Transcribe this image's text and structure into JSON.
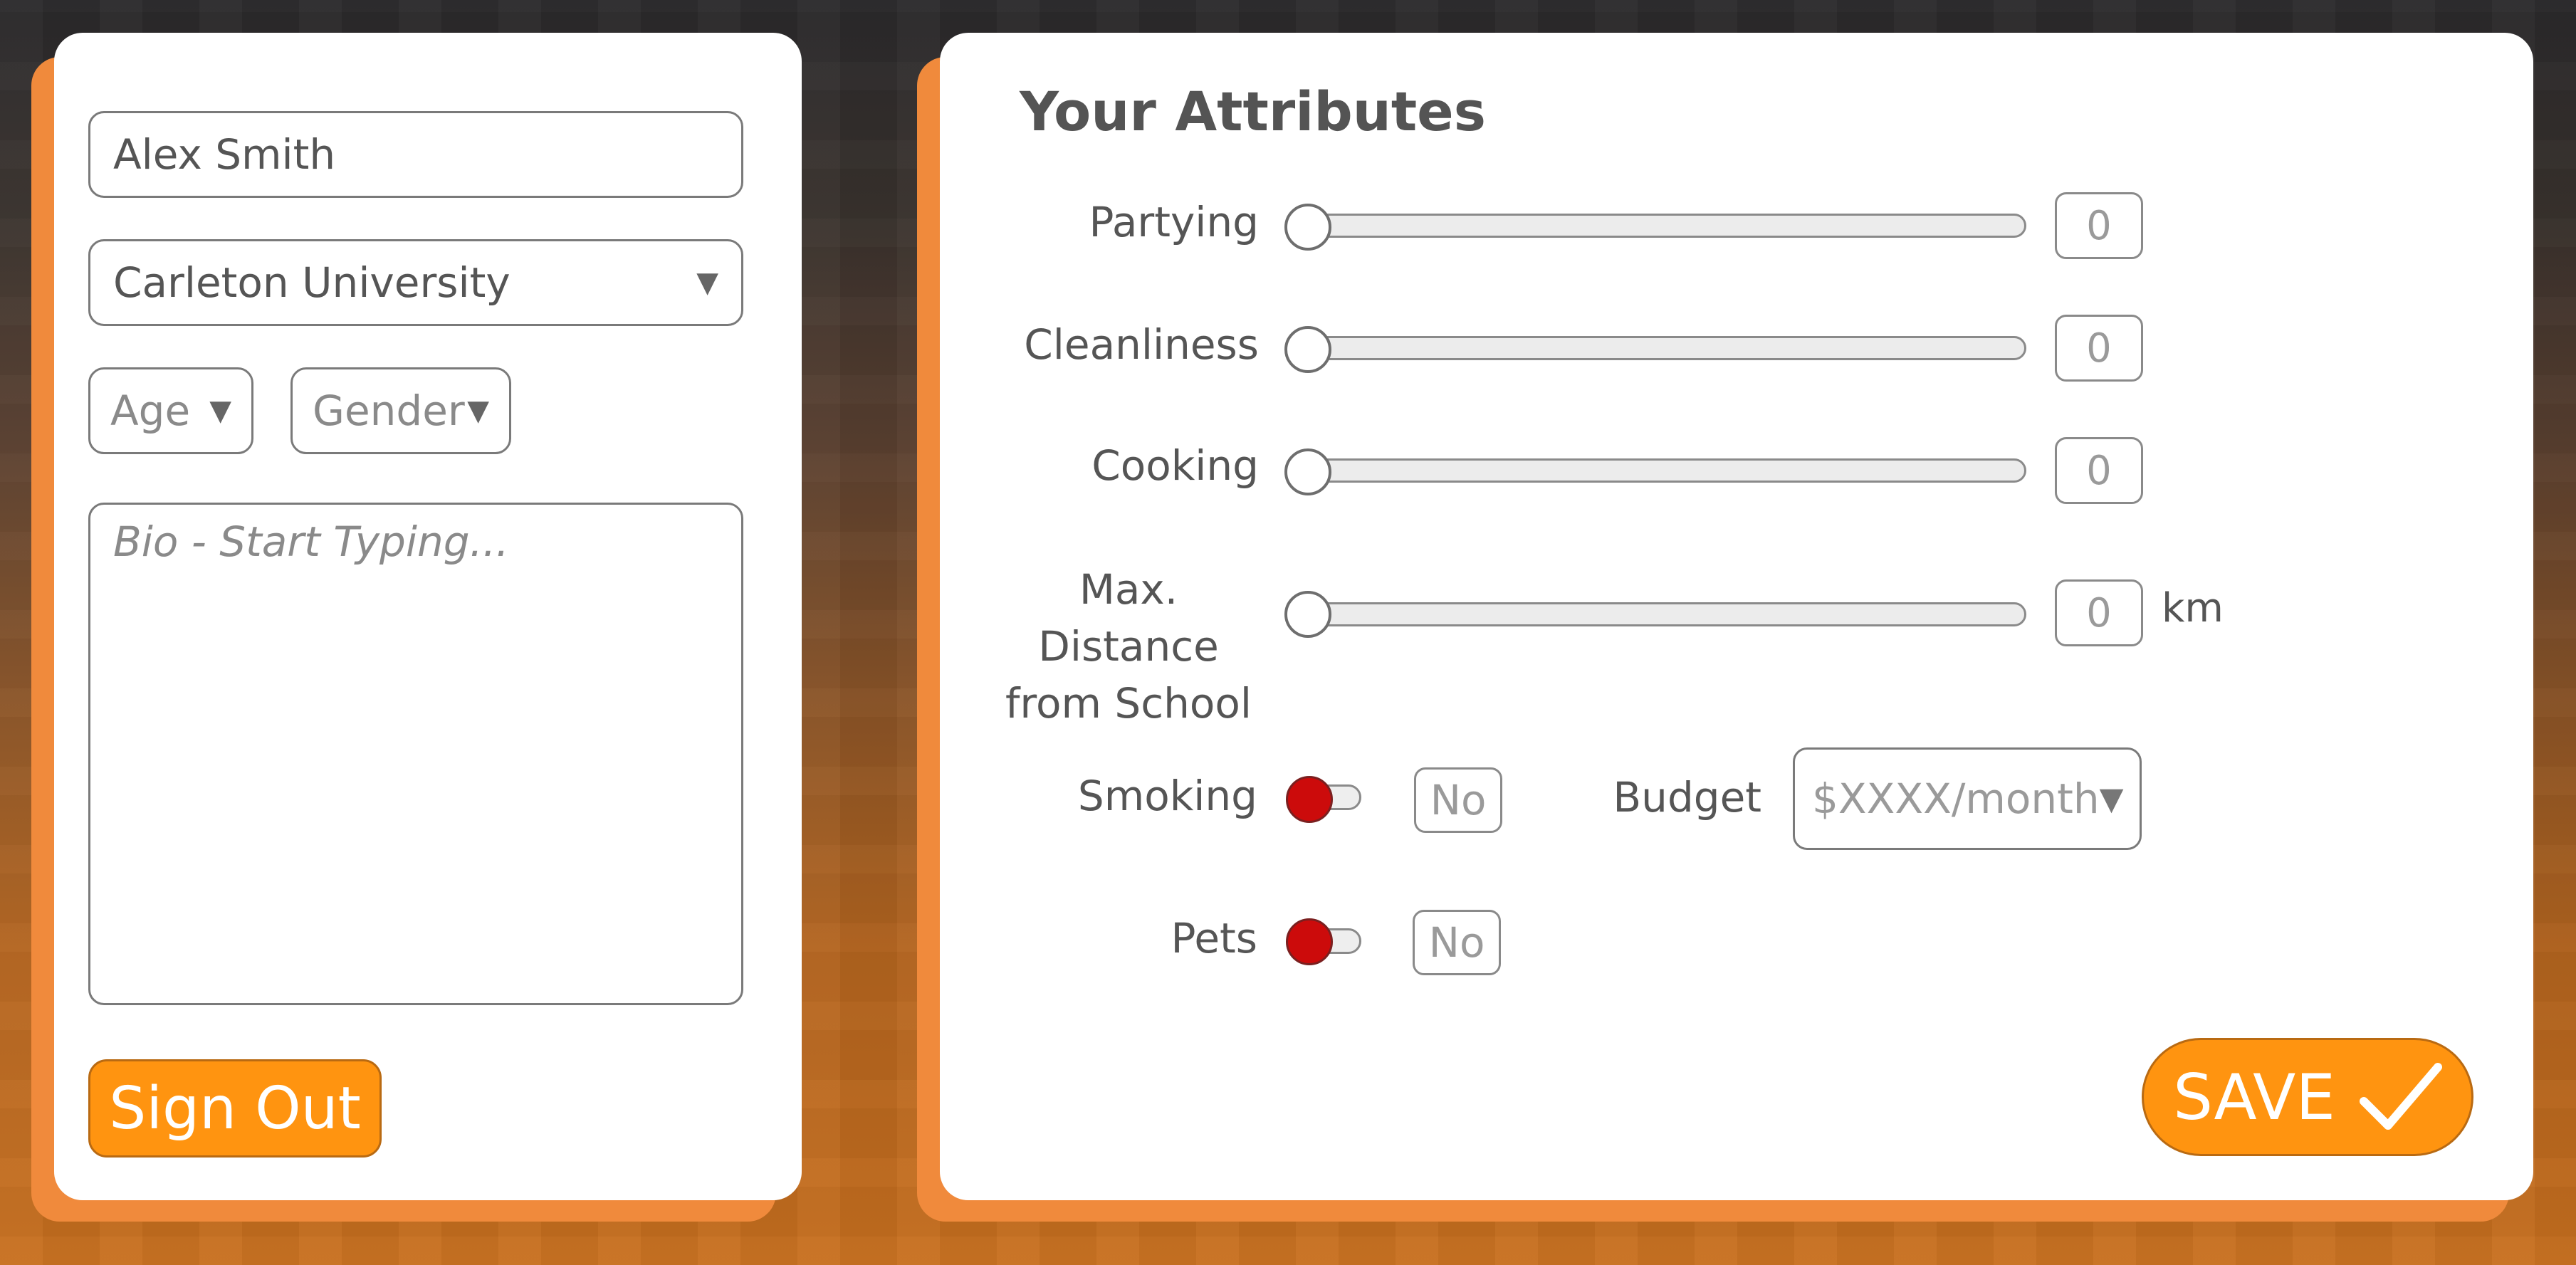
{
  "profile": {
    "name_value": "Alex Smith",
    "school_value": "Carleton University",
    "age_placeholder": "Age",
    "gender_placeholder": "Gender",
    "bio_placeholder": "Bio - Start Typing...",
    "sign_out_label": "Sign Out"
  },
  "attributes": {
    "title": "Your Attributes",
    "sliders": [
      {
        "label": "Partying",
        "value": "0"
      },
      {
        "label": "Cleanliness",
        "value": "0"
      },
      {
        "label": "Cooking",
        "value": "0"
      },
      {
        "label": "Max. Distance\nfrom School",
        "value": "0",
        "unit": "km"
      }
    ],
    "toggles": [
      {
        "label": "Smoking",
        "value": "No"
      },
      {
        "label": "Pets",
        "value": "No"
      }
    ],
    "budget": {
      "label": "Budget",
      "placeholder": "$XXXX/month"
    },
    "save_label": "SAVE"
  },
  "colors": {
    "accent": "#ff9410",
    "card_shadow": "#f08a3c",
    "toggle_off": "#cc0b0b"
  },
  "icons": {
    "dropdown": "chevron-down-icon",
    "save": "checkmark-icon"
  }
}
